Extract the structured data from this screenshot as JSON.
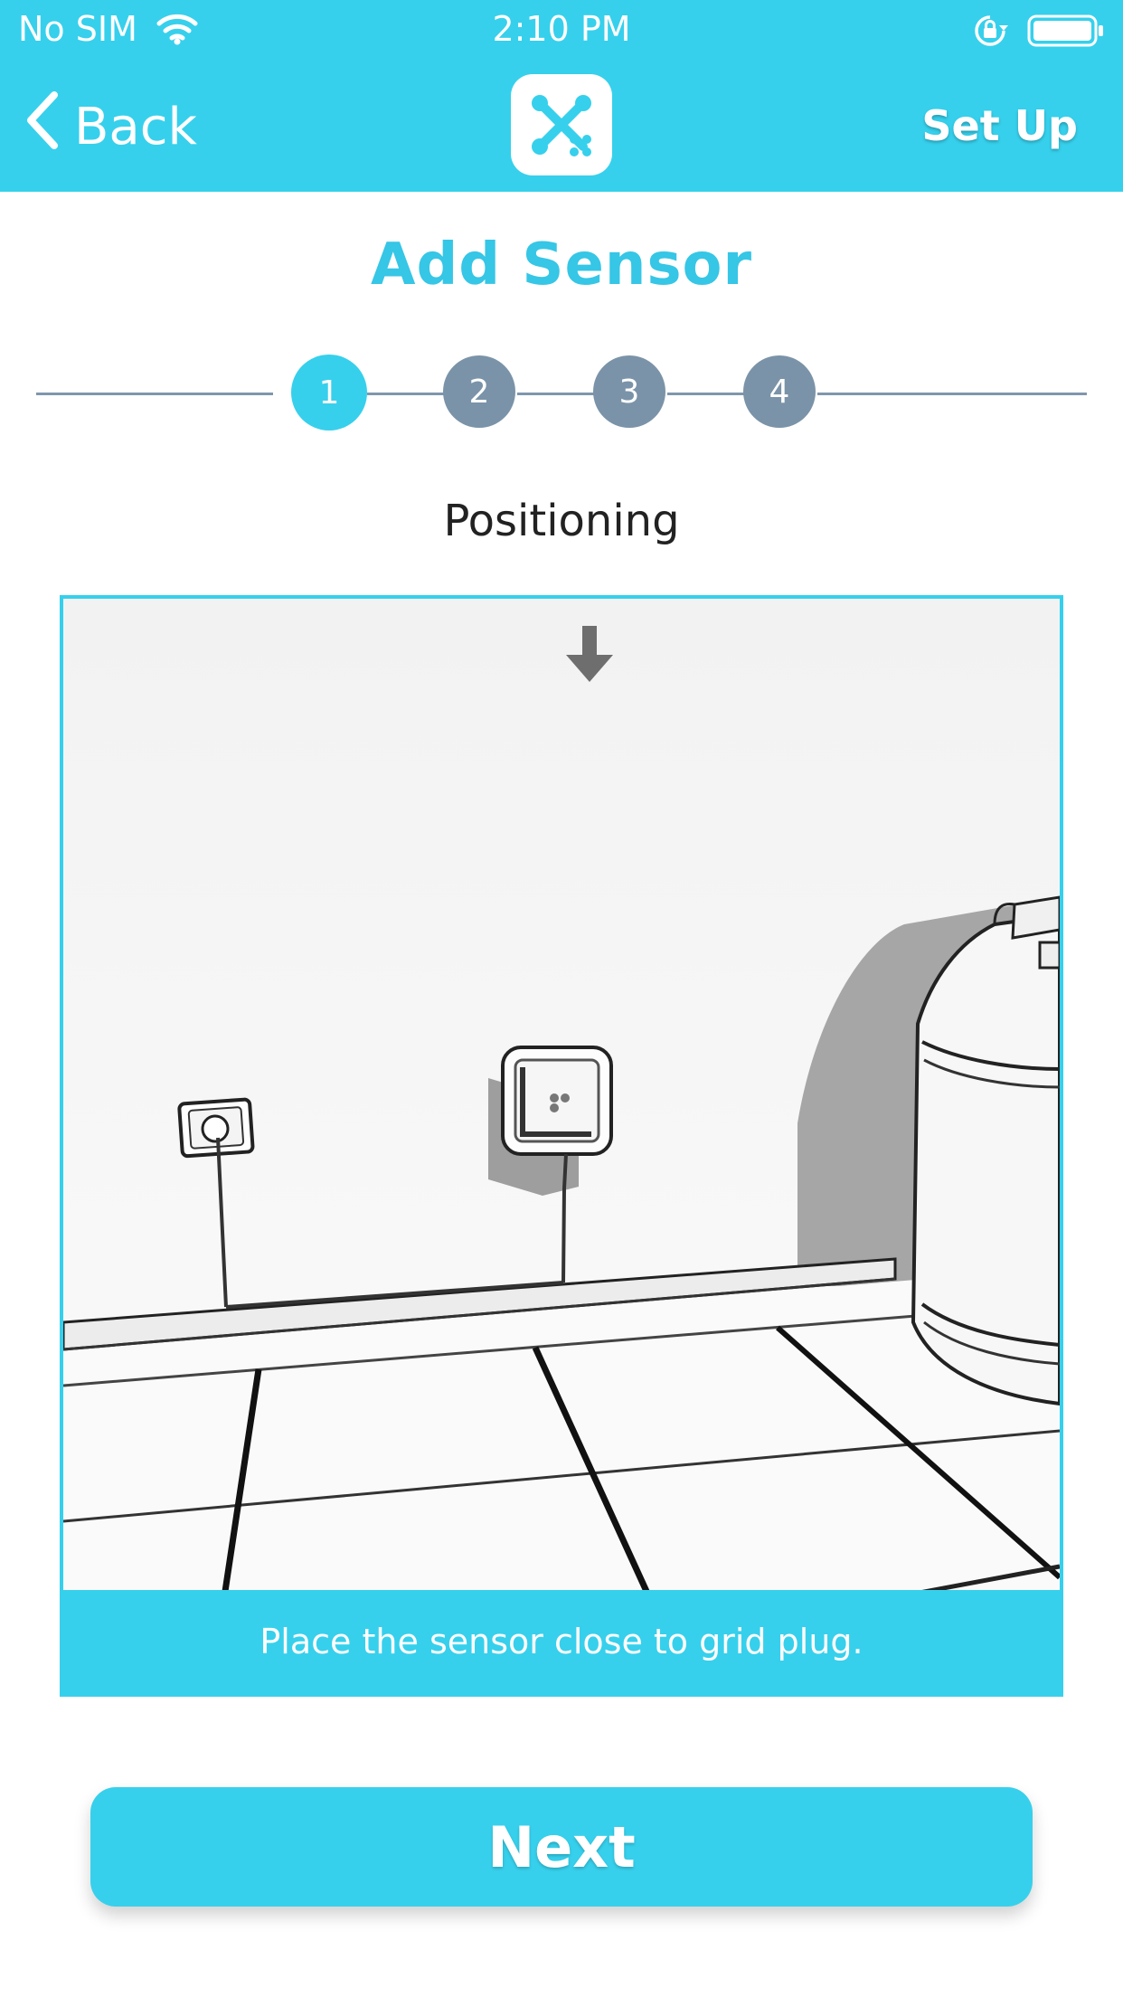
{
  "colors": {
    "accent": "#36d0ec",
    "step_inactive": "#7a93a8",
    "title": "#36c6e6",
    "white": "#ffffff"
  },
  "status_bar": {
    "carrier": "No SIM",
    "time": "2:10 PM",
    "icons": [
      "wifi-icon",
      "orientation-lock-icon",
      "battery-icon"
    ]
  },
  "nav": {
    "back_label": "Back",
    "logo_icon": "app-logo-icon",
    "setup_label": "Set Up"
  },
  "page": {
    "title": "Add Sensor",
    "steps": [
      {
        "label": "1",
        "active": true
      },
      {
        "label": "2",
        "active": false
      },
      {
        "label": "3",
        "active": false
      },
      {
        "label": "4",
        "active": false
      }
    ],
    "step_title": "Positioning",
    "caption": "Place the sensor close to grid plug.",
    "next_label": "Next"
  }
}
